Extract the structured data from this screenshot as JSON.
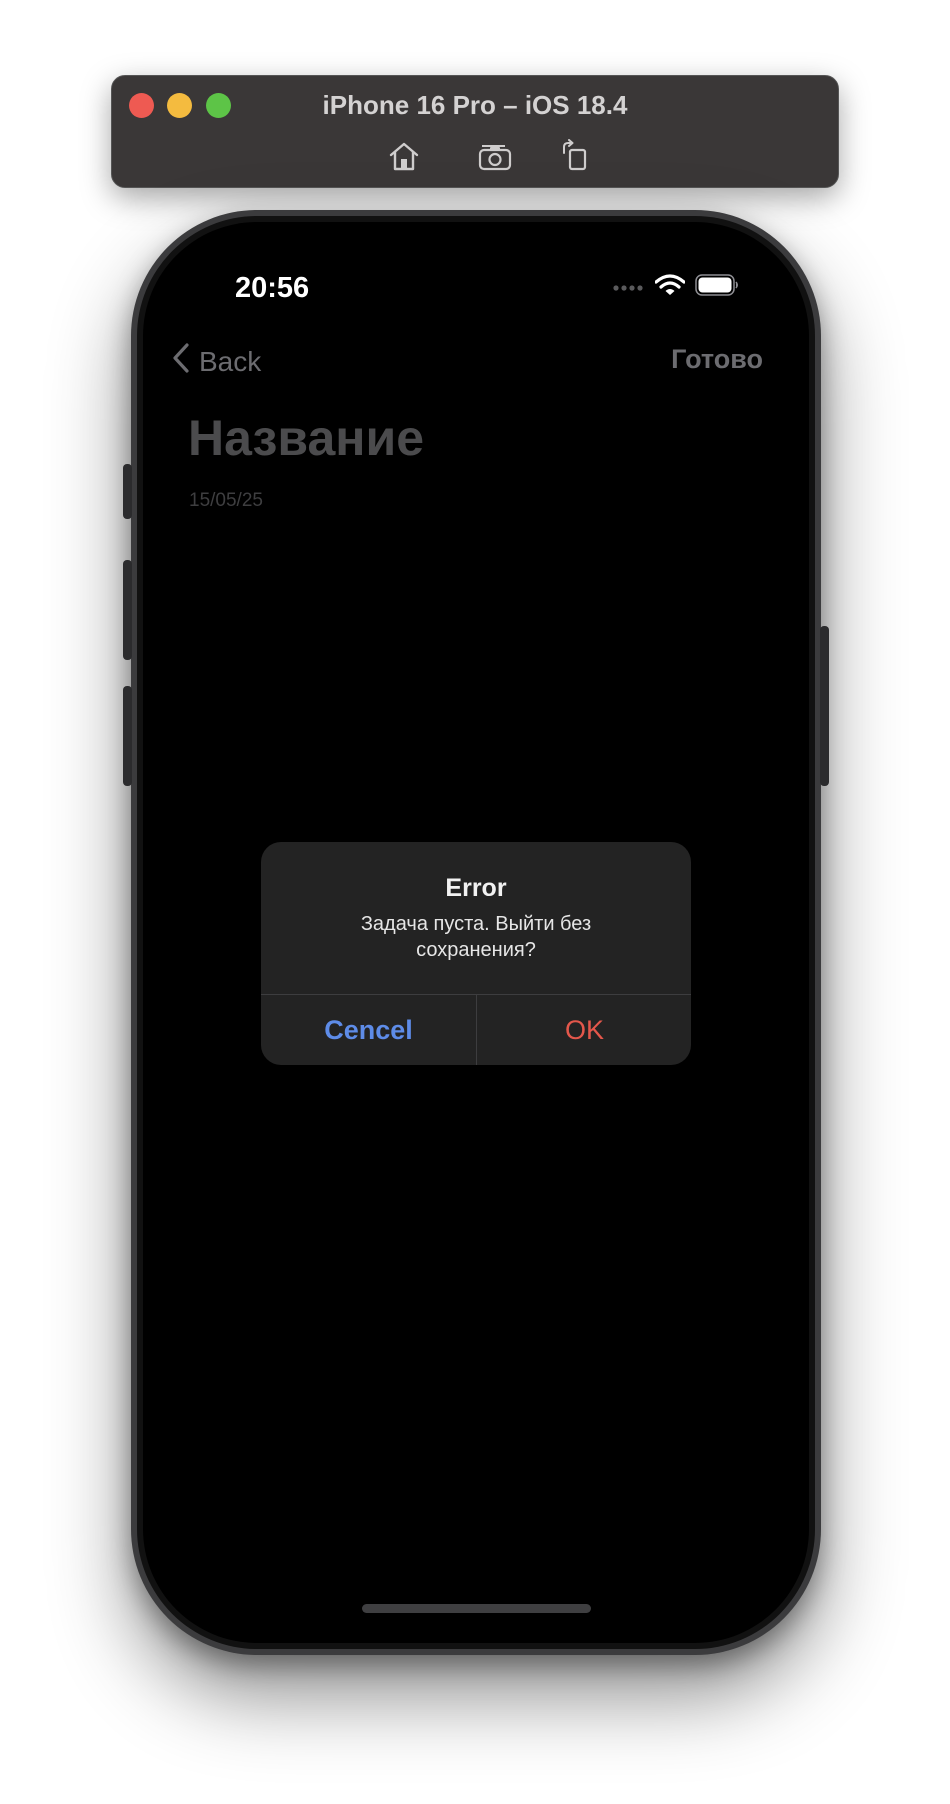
{
  "simulator": {
    "title": "iPhone 16 Pro – iOS 18.4",
    "toolbar_icons": [
      "home-icon",
      "screenshot-icon",
      "rotate-icon"
    ]
  },
  "status_bar": {
    "time": "20:56",
    "icons": [
      "signal-icon",
      "wifi-icon",
      "battery-icon"
    ]
  },
  "nav": {
    "back_label": "Back",
    "done_label": "Готово"
  },
  "note": {
    "title": "Название",
    "date": "15/05/25"
  },
  "alert": {
    "title": "Error",
    "message": "Задача пуста. Выйти без сохранения?",
    "cancel_label": "Cencel",
    "ok_label": "OK"
  },
  "colors": {
    "cancel": "#5e8ce8",
    "ok": "#e4574b",
    "alert_bg": "#232323",
    "screen_bg": "#000000"
  }
}
